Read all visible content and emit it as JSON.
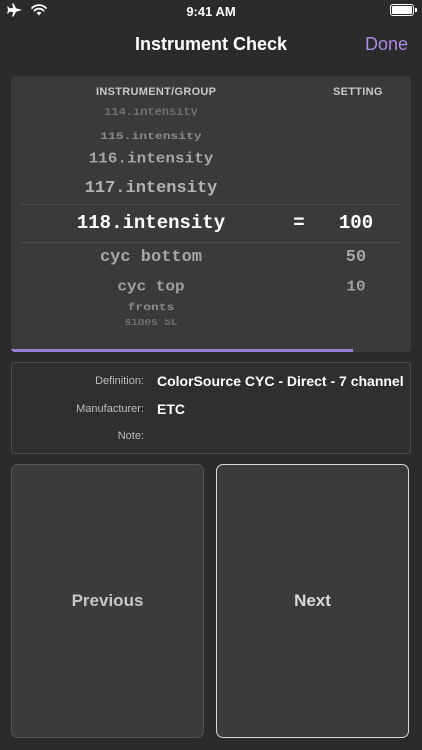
{
  "status": {
    "time": "9:41 AM"
  },
  "nav": {
    "title": "Instrument Check",
    "done_label": "Done"
  },
  "picker": {
    "header_left": "INSTRUMENT/GROUP",
    "header_right": "SETTING",
    "rows_left": [
      "114.intensity",
      "115.intensity",
      "116.intensity",
      "117.intensity",
      "118.intensity",
      "cyc bottom",
      "cyc top",
      "fronts",
      "sides SL"
    ],
    "equals": "=",
    "rows_right": [
      "100",
      "50",
      "10"
    ],
    "progress": 0.855
  },
  "info": {
    "definition_label": "Definition:",
    "definition_value": "ColorSource CYC - Direct - 7 channel",
    "manufacturer_label": "Manufacturer:",
    "manufacturer_value": "ETC",
    "note_label": "Note:",
    "note_value": ""
  },
  "buttons": {
    "previous": "Previous",
    "next": "Next"
  },
  "colors": {
    "accent": "#a98ce0",
    "progress": "#9b7fd6",
    "background": "#2b2b2b",
    "panel": "#3a3a3a"
  }
}
